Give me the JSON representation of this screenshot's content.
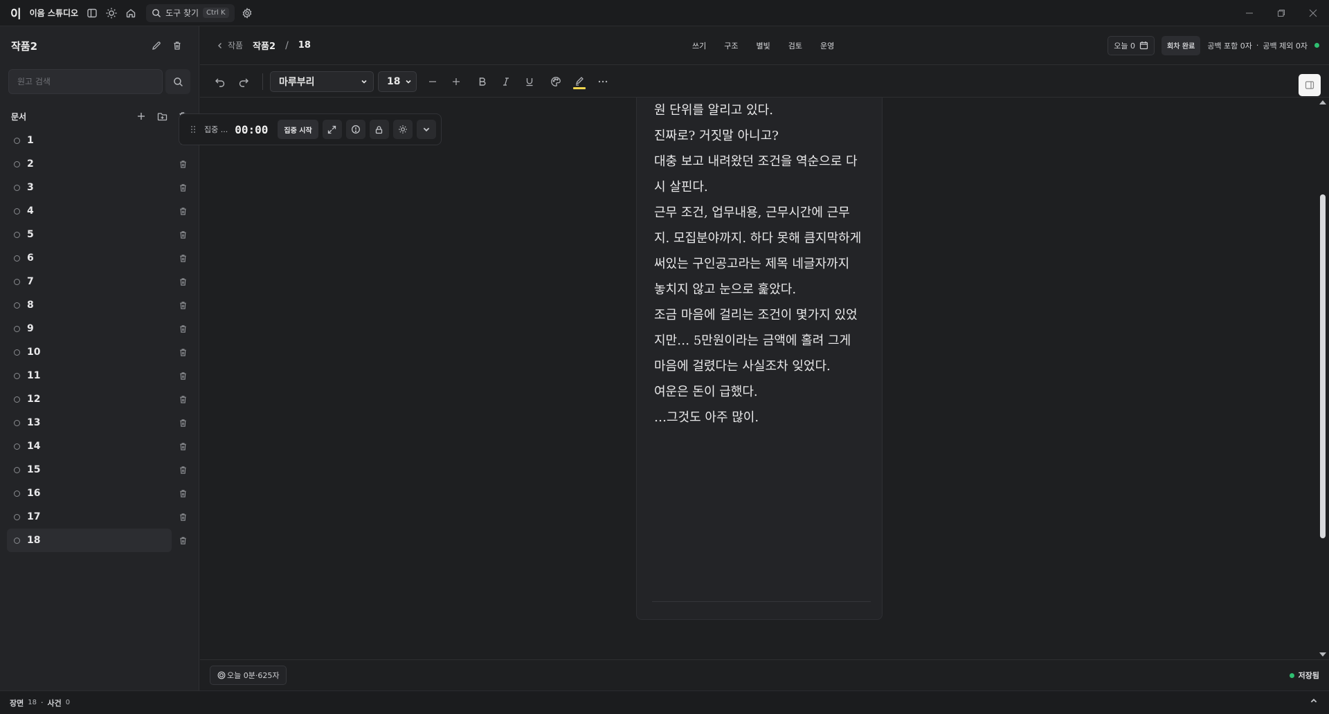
{
  "titlebar": {
    "logo": "이",
    "app_name": "이음 스튜디오",
    "search_label": "도구 찾기",
    "search_shortcut": "Ctrl K"
  },
  "sidebar": {
    "project_title": "작품2",
    "search_placeholder": "원고 검색",
    "docs_label": "문서",
    "documents": [
      "1",
      "2",
      "3",
      "4",
      "5",
      "6",
      "7",
      "8",
      "9",
      "10",
      "11",
      "12",
      "13",
      "14",
      "15",
      "16",
      "17",
      "18"
    ],
    "active_document": "18"
  },
  "header": {
    "back_label": "작품",
    "project": "작품2",
    "separator": "/",
    "document": "18",
    "modes": [
      "쓰기",
      "구조",
      "별빛",
      "검토",
      "운영"
    ],
    "today_label": "오늘 0",
    "done_label": "회차 완료",
    "count_with_spaces": "공백 포함 0자",
    "dot_sep": "·",
    "count_without_spaces": "공백 제외 0자",
    "status_color": "#2fbf71"
  },
  "toolbar": {
    "font_family": "마루부리",
    "font_size": "18",
    "highlight_color": "#f2d74e"
  },
  "focus_widget": {
    "label": "집중 ...",
    "time": "00:00",
    "start_label": "집중 시작"
  },
  "editor": {
    "paragraphs": [
      "원 단위를 알리고 있다.",
      "진짜로? 거짓말 아니고?",
      "대충 보고 내려왔던 조건을 역순으로 다시 살핀다.",
      "근무 조건, 업무내용, 근무시간에 근무지. 모집분야까지. 하다 못해 큼지막하게 써있는 구인공고라는 제목 네글자까지 놓치지 않고 눈으로 훑았다.",
      "조금 마음에 걸리는 조건이 몇가지 있었지만… 5만원이라는 금액에 홀려 그게 마음에 걸렸다는 사실조차 잊었다.",
      "여운은 돈이 급했다.",
      "…그것도 아주 많이."
    ]
  },
  "status": {
    "today_stats": "오늘 0분·625자",
    "saved_label": "저장됨"
  },
  "footer": {
    "scene_label": "장면",
    "scene_count": "18",
    "dot": "·",
    "event_label": "사건",
    "event_count": "0"
  }
}
